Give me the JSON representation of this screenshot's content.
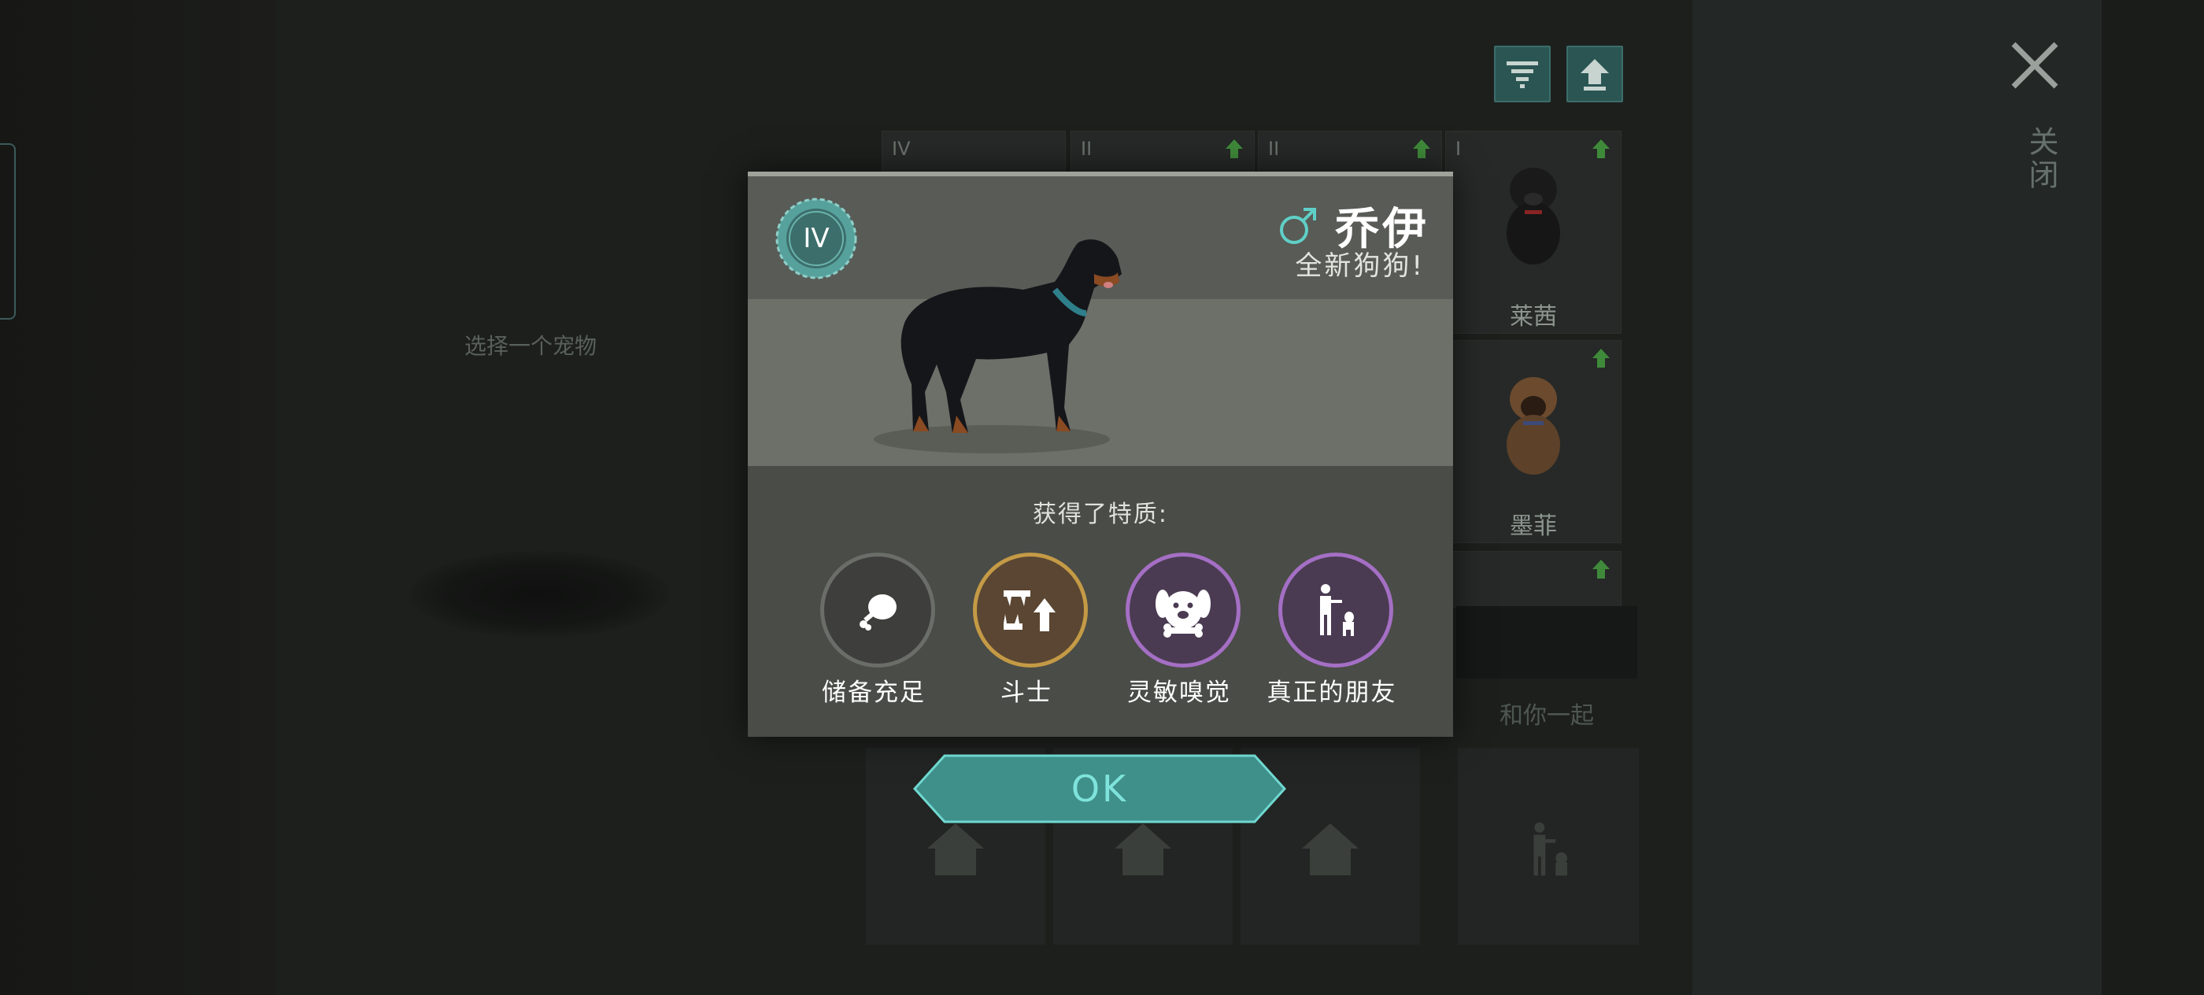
{
  "background": {
    "select_pet_hint": "选择一个宠物",
    "close_label": "关闭",
    "with_you_label": "和你一起",
    "grid_cells": [
      {
        "roman": "IV",
        "name": "",
        "upgrade": false
      },
      {
        "roman": "II",
        "name": "",
        "upgrade": true
      },
      {
        "roman": "II",
        "name": "",
        "upgrade": true
      },
      {
        "roman": "I",
        "name": "莱茜",
        "upgrade": true
      },
      {
        "roman": "",
        "name": "墨菲",
        "upgrade": true
      },
      {
        "roman": "",
        "name": "",
        "upgrade": true
      }
    ]
  },
  "modal": {
    "level": "IV",
    "gender_icon": "male-icon",
    "pet_name": "乔伊",
    "subtitle": "全新狗狗!",
    "traits_title": "获得了特质:",
    "traits": [
      {
        "label": "储备充足",
        "icon": "meat-icon",
        "ring_color": "#6b6d68",
        "fill_color": "#3e3f3c"
      },
      {
        "label": "斗士",
        "icon": "fangs-up-icon",
        "ring_color": "#c49a46",
        "fill_color": "#5a4632"
      },
      {
        "label": "灵敏嗅觉",
        "icon": "dog-face-icon",
        "ring_color": "#a46fc4",
        "fill_color": "#4a3b52"
      },
      {
        "label": "真正的朋友",
        "icon": "person-with-dog-icon",
        "ring_color": "#a46fc4",
        "fill_color": "#4a3b52"
      }
    ]
  },
  "ok_button": {
    "label": "OK"
  },
  "colors": {
    "accent_teal": "#3f8f8a",
    "ok_text": "#7fe3dc",
    "upgrade_green": "#3f8a3a",
    "badge_teal": "#3f7a77"
  }
}
